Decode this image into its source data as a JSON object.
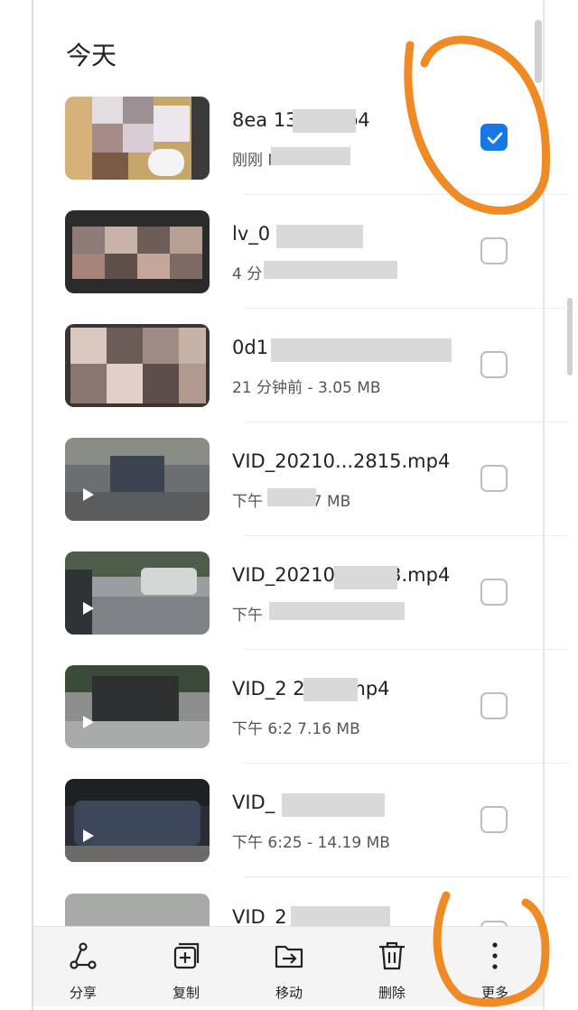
{
  "section": {
    "title": "今天"
  },
  "files": [
    {
      "name": "8ea  130e.mp4",
      "meta": "刚刚  MB",
      "checked": true,
      "play": false
    },
    {
      "name": "lv_0  .mp4",
      "meta": "4 分",
      "checked": false,
      "play": false
    },
    {
      "name": "0d1  4",
      "meta": "21 分钟前 - 3.05 MB",
      "checked": false,
      "play": false
    },
    {
      "name": "VID_20210...2815.mp4",
      "meta": "下午  - 15.77 MB",
      "checked": false,
      "play": true
    },
    {
      "name": "VID_20210...2803.mp4",
      "meta": "下午",
      "checked": false,
      "play": true
    },
    {
      "name": "VID_2  2716.mp4",
      "meta": "下午 6:2  7.16 MB",
      "checked": false,
      "play": true
    },
    {
      "name": "VID_  9.mp4",
      "meta": "下午 6:25 - 14.19 MB",
      "checked": false,
      "play": true
    },
    {
      "name": "VID_2  2258.mp4",
      "meta": "",
      "checked": false,
      "play": false
    }
  ],
  "toolbar": {
    "share": {
      "label": "分享",
      "icon": "share-icon"
    },
    "copy": {
      "label": "复制",
      "icon": "copy-icon"
    },
    "move": {
      "label": "移动",
      "icon": "move-icon"
    },
    "delete": {
      "label": "删除",
      "icon": "delete-icon"
    },
    "more": {
      "label": "更多",
      "icon": "more-vertical-icon"
    }
  },
  "colors": {
    "accent": "#1677e8",
    "annotation": "#f08a24"
  }
}
